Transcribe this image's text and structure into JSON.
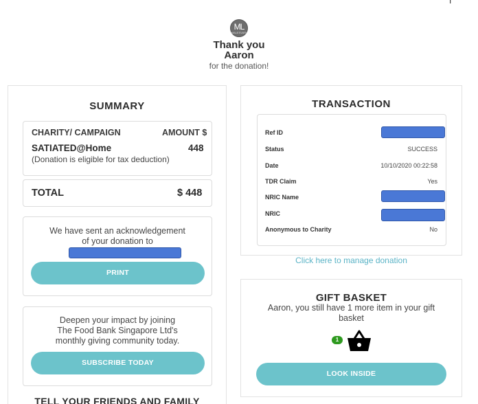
{
  "corner_mark": "I'",
  "header": {
    "logo_initials": "ML",
    "logo_sub": "MALESVARI",
    "thanks": "Thank you",
    "name": "Aaron",
    "for_text": "for the donation!"
  },
  "summary": {
    "title": "SUMMARY",
    "col_charity": "CHARITY/ CAMPAIGN",
    "col_amount": "AMOUNT $",
    "campaign": "SATIATED@Home",
    "campaign_amount": "448",
    "tax_note": "(Donation is eligible for tax deduction)",
    "total_label": "TOTAL",
    "total_value": "$ 448"
  },
  "acknowledgement": {
    "line1": "We have sent an acknowledgement",
    "line2": "of your donation to",
    "print_label": "PRINT"
  },
  "subscribe": {
    "line1": "Deepen your impact by joining",
    "line2": "The Food Bank Singapore Ltd's",
    "line3": "monthly giving community today.",
    "button_label": "SUBSCRIBE TODAY"
  },
  "bottom_title": "TELL YOUR FRIENDS AND FAMILY",
  "transaction": {
    "title": "TRANSACTION",
    "rows": [
      {
        "label": "Ref ID",
        "value": ""
      },
      {
        "label": "Status",
        "value": "SUCCESS"
      },
      {
        "label": "Date",
        "value": "10/10/2020 00:22:58"
      },
      {
        "label": "TDR Claim",
        "value": "Yes"
      },
      {
        "label": "NRIC Name",
        "value": ""
      },
      {
        "label": "NRIC",
        "value": ""
      },
      {
        "label": "Anonymous to Charity",
        "value": "No"
      }
    ],
    "manage_link": "Click here to manage donation"
  },
  "gift_basket": {
    "title": "GIFT BASKET",
    "line1": "Aaron, you still have 1 more item in your gift",
    "line2": "basket",
    "count": "1",
    "button_label": "LOOK INSIDE"
  },
  "colors": {
    "button": "#6cc3cb",
    "link": "#5ab3c6",
    "redaction": "#4a78d6",
    "badge": "#2e9a1f"
  }
}
